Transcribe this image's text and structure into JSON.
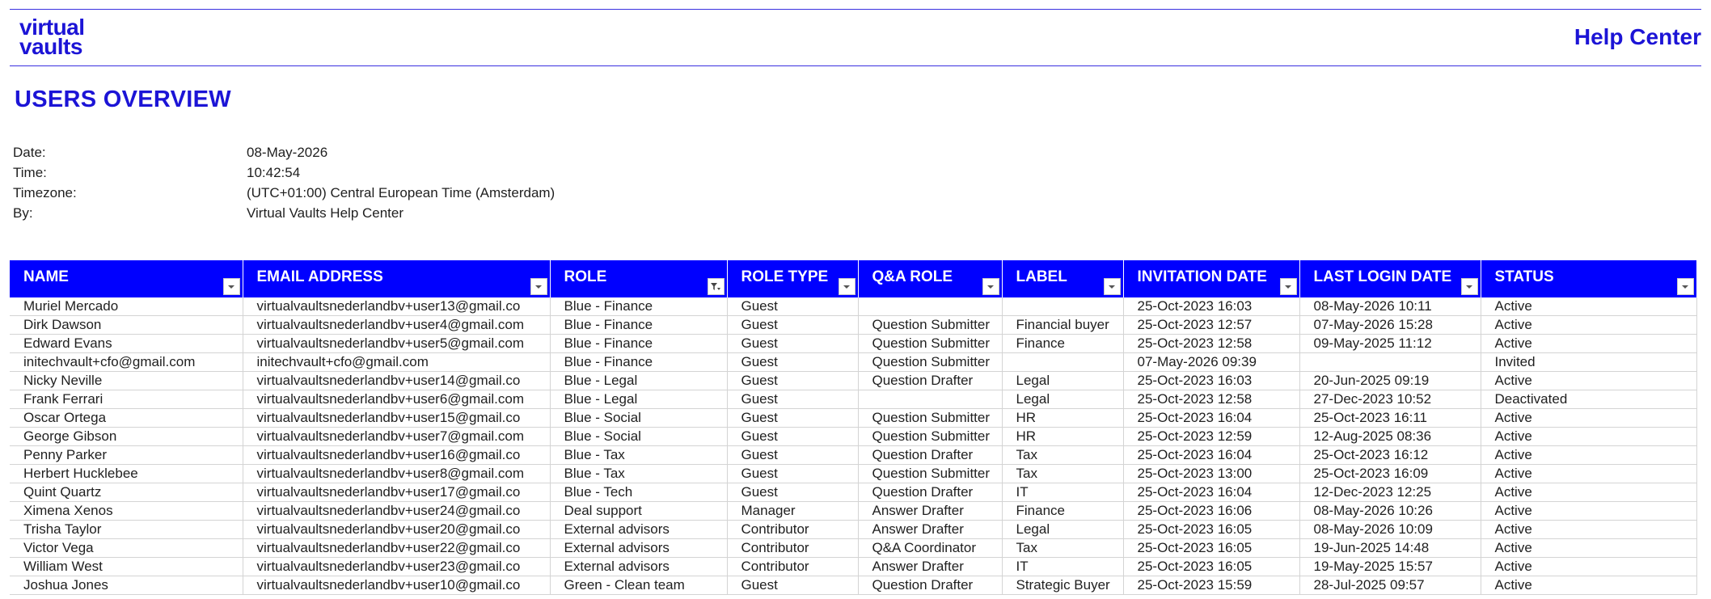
{
  "brand": {
    "logo_line1": "virtual",
    "logo_line2": "vaults",
    "help_center": "Help Center",
    "accent": "#1c14d6",
    "header_bg": "#0000ff"
  },
  "page_title": "USERS OVERVIEW",
  "meta": [
    {
      "key": "Date:",
      "value": "08-May-2026"
    },
    {
      "key": "Time:",
      "value": "10:42:54"
    },
    {
      "key": "Timezone:",
      "value": "(UTC+01:00) Central European Time (Amsterdam)"
    },
    {
      "key": "By:",
      "value": "Virtual Vaults Help Center"
    }
  ],
  "chart_data": {
    "type": "table",
    "columns": [
      "NAME",
      "EMAIL ADDRESS",
      "ROLE",
      "ROLE TYPE",
      "Q&A ROLE",
      "LABEL",
      "INVITATION DATE",
      "LAST LOGIN DATE",
      "STATUS"
    ],
    "filter_icons": [
      "dropdown",
      "dropdown",
      "filter-active",
      "dropdown",
      "dropdown",
      "dropdown",
      "dropdown",
      "dropdown",
      "dropdown"
    ],
    "rows": [
      [
        "Muriel Mercado",
        "virtualvaultsnederlandbv+user13@gmail.co",
        "Blue - Finance",
        "Guest",
        "",
        "",
        "25-Oct-2023 16:03",
        "08-May-2026 10:11",
        "Active"
      ],
      [
        "Dirk Dawson",
        "virtualvaultsnederlandbv+user4@gmail.com",
        "Blue - Finance",
        "Guest",
        "Question Submitter",
        "Financial buyer",
        "25-Oct-2023 12:57",
        "07-May-2026 15:28",
        "Active"
      ],
      [
        "Edward Evans",
        "virtualvaultsnederlandbv+user5@gmail.com",
        "Blue - Finance",
        "Guest",
        "Question Submitter",
        "Finance",
        "25-Oct-2023 12:58",
        "09-May-2025 11:12",
        "Active"
      ],
      [
        "initechvault+cfo@gmail.com",
        "initechvault+cfo@gmail.com",
        "Blue - Finance",
        "Guest",
        "Question Submitter",
        "",
        "07-May-2026 09:39",
        "",
        "Invited"
      ],
      [
        "Nicky Neville",
        "virtualvaultsnederlandbv+user14@gmail.co",
        "Blue - Legal",
        "Guest",
        "Question Drafter",
        "Legal",
        "25-Oct-2023 16:03",
        "20-Jun-2025 09:19",
        "Active"
      ],
      [
        "Frank Ferrari",
        "virtualvaultsnederlandbv+user6@gmail.com",
        "Blue - Legal",
        "Guest",
        "",
        "Legal",
        "25-Oct-2023 12:58",
        "27-Dec-2023 10:52",
        "Deactivated"
      ],
      [
        "Oscar Ortega",
        "virtualvaultsnederlandbv+user15@gmail.co",
        "Blue - Social",
        "Guest",
        "Question Submitter",
        "HR",
        "25-Oct-2023 16:04",
        "25-Oct-2023 16:11",
        "Active"
      ],
      [
        "George Gibson",
        "virtualvaultsnederlandbv+user7@gmail.com",
        "Blue - Social",
        "Guest",
        "Question Submitter",
        "HR",
        "25-Oct-2023 12:59",
        "12-Aug-2025 08:36",
        "Active"
      ],
      [
        "Penny Parker",
        "virtualvaultsnederlandbv+user16@gmail.co",
        "Blue - Tax",
        "Guest",
        "Question Drafter",
        "Tax",
        "25-Oct-2023 16:04",
        "25-Oct-2023 16:12",
        "Active"
      ],
      [
        "Herbert Hucklebee",
        "virtualvaultsnederlandbv+user8@gmail.com",
        "Blue - Tax",
        "Guest",
        "Question Submitter",
        "Tax",
        "25-Oct-2023 13:00",
        "25-Oct-2023 16:09",
        "Active"
      ],
      [
        "Quint Quartz",
        "virtualvaultsnederlandbv+user17@gmail.co",
        "Blue - Tech",
        "Guest",
        "Question Drafter",
        "IT",
        "25-Oct-2023 16:04",
        "12-Dec-2023 12:25",
        "Active"
      ],
      [
        "Ximena Xenos",
        "virtualvaultsnederlandbv+user24@gmail.co",
        "Deal support",
        "Manager",
        "Answer Drafter",
        "Finance",
        "25-Oct-2023 16:06",
        "08-May-2026 10:26",
        "Active"
      ],
      [
        "Trisha Taylor",
        "virtualvaultsnederlandbv+user20@gmail.co",
        "External advisors",
        "Contributor",
        "Answer Drafter",
        "Legal",
        "25-Oct-2023 16:05",
        "08-May-2026 10:09",
        "Active"
      ],
      [
        "Victor Vega",
        "virtualvaultsnederlandbv+user22@gmail.co",
        "External advisors",
        "Contributor",
        "Q&A Coordinator",
        "Tax",
        "25-Oct-2023 16:05",
        "19-Jun-2025 14:48",
        "Active"
      ],
      [
        "William West",
        "virtualvaultsnederlandbv+user23@gmail.co",
        "External advisors",
        "Contributor",
        "Answer Drafter",
        "IT",
        "25-Oct-2023 16:05",
        "19-May-2025 15:57",
        "Active"
      ],
      [
        "Joshua Jones",
        "virtualvaultsnederlandbv+user10@gmail.co",
        "Green - Clean team",
        "Guest",
        "Question Drafter",
        "Strategic Buyer",
        "25-Oct-2023 15:59",
        "28-Jul-2025 09:57",
        "Active"
      ]
    ]
  }
}
